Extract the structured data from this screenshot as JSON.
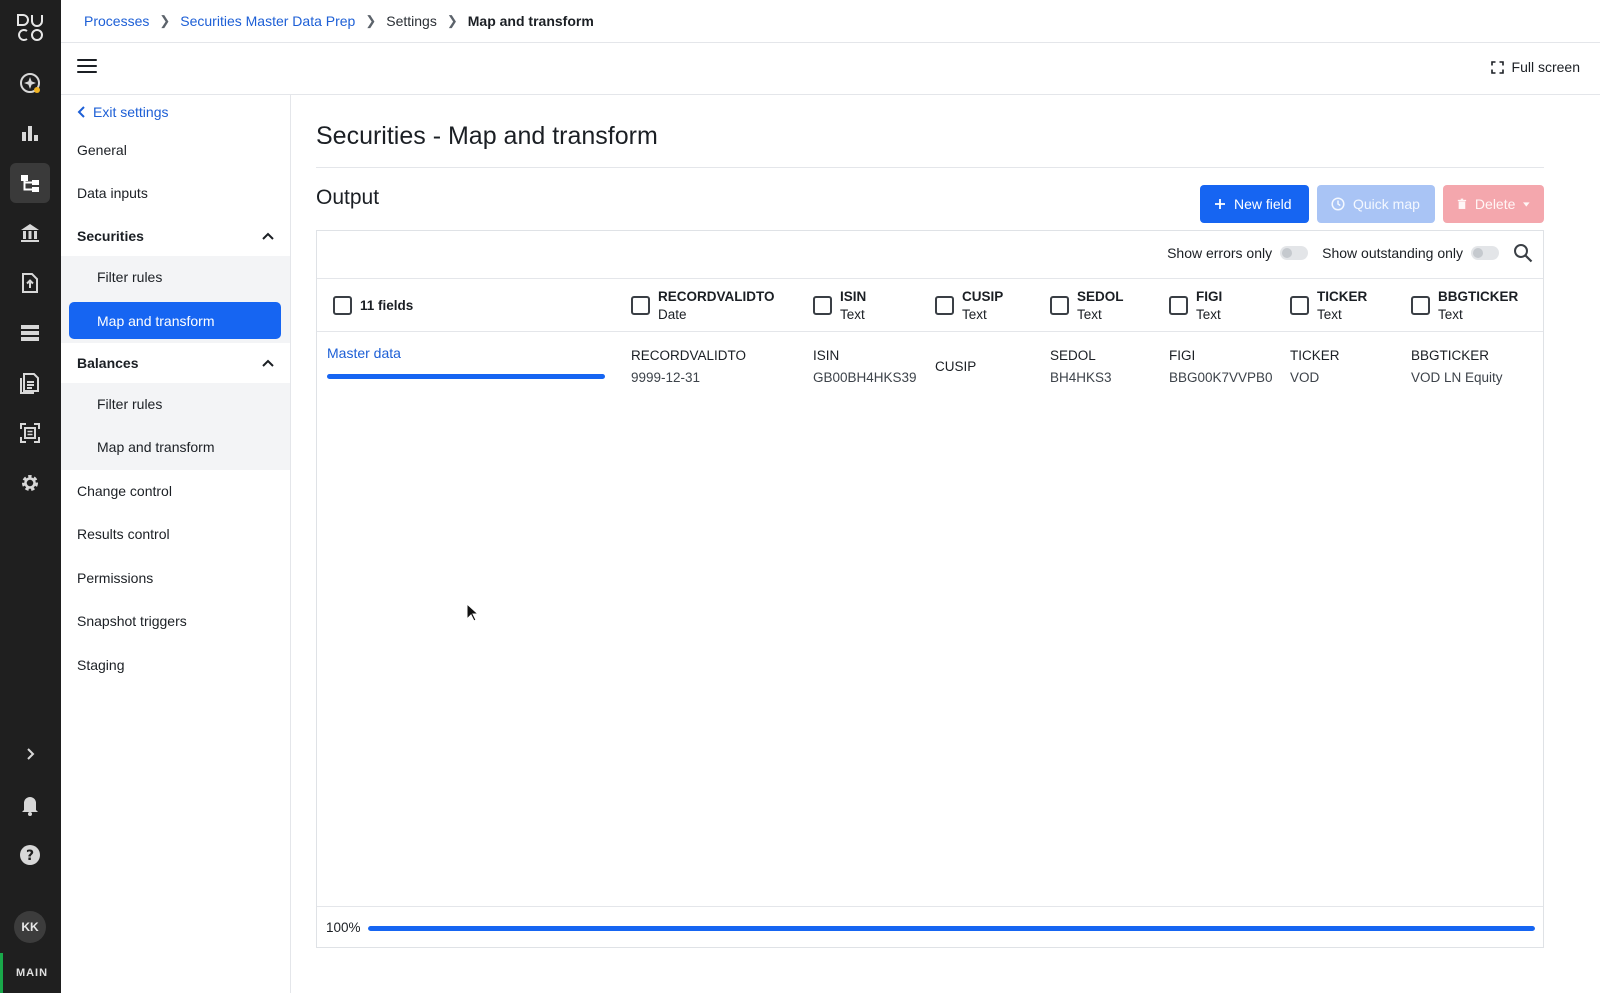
{
  "rail": {
    "env": "MAIN",
    "avatar": "KK",
    "icons": [
      "duco-logo",
      "sparkle-icon",
      "bar-chart-icon",
      "process-tree-icon",
      "bank-icon",
      "file-upload-icon",
      "list-icon",
      "report-icon",
      "scan-icon",
      "gear-icon",
      "chevron-right-icon",
      "bell-icon",
      "help-icon"
    ]
  },
  "breadcrumb": {
    "items": [
      "Processes",
      "Securities Master Data Prep",
      "Settings",
      "Map and transform"
    ]
  },
  "toolbar": {
    "fullscreen_label": "Full screen"
  },
  "sidenav": {
    "exit_label": "Exit settings",
    "general": "General",
    "data_inputs": "Data inputs",
    "securities": {
      "label": "Securities",
      "filter_rules": "Filter rules",
      "map_transform": "Map and transform"
    },
    "balances": {
      "label": "Balances",
      "filter_rules": "Filter rules",
      "map_transform": "Map and transform"
    },
    "change_control": "Change control",
    "results_control": "Results control",
    "permissions": "Permissions",
    "snapshot_triggers": "Snapshot triggers",
    "staging": "Staging"
  },
  "content": {
    "page_title": "Securities - Map and transform",
    "section_title": "Output",
    "buttons": {
      "new_field": "New field",
      "quick_map": "Quick map",
      "delete": "Delete"
    },
    "filters": {
      "errors_only": "Show errors only",
      "outstanding_only": "Show outstanding only"
    },
    "table": {
      "field_count": "11 fields",
      "columns": [
        {
          "name": "RECORDVALIDTO",
          "type": "Date"
        },
        {
          "name": "ISIN",
          "type": "Text"
        },
        {
          "name": "CUSIP",
          "type": "Text"
        },
        {
          "name": "SEDOL",
          "type": "Text"
        },
        {
          "name": "FIGI",
          "type": "Text"
        },
        {
          "name": "TICKER",
          "type": "Text"
        },
        {
          "name": "BBGTICKER",
          "type": "Text"
        }
      ],
      "row": {
        "source": "Master data",
        "source_progress": 1.0,
        "cells": [
          {
            "key": "RECORDVALIDTO",
            "value": "9999-12-31"
          },
          {
            "key": "ISIN",
            "value": "GB00BH4HKS39"
          },
          {
            "key": "CUSIP",
            "value": ""
          },
          {
            "key": "SEDOL",
            "value": "BH4HKS3"
          },
          {
            "key": "FIGI",
            "value": "BBG00K7VVPB0"
          },
          {
            "key": "TICKER",
            "value": "VOD"
          },
          {
            "key": "BBGTICKER",
            "value": "VOD LN Equity"
          }
        ]
      }
    },
    "progress": {
      "label": "100%",
      "value": 1.0
    }
  },
  "colors": {
    "accent": "#1665f2",
    "link": "#1d5fd6",
    "rail": "#1f1f1f",
    "env_indicator": "#19a84a"
  }
}
